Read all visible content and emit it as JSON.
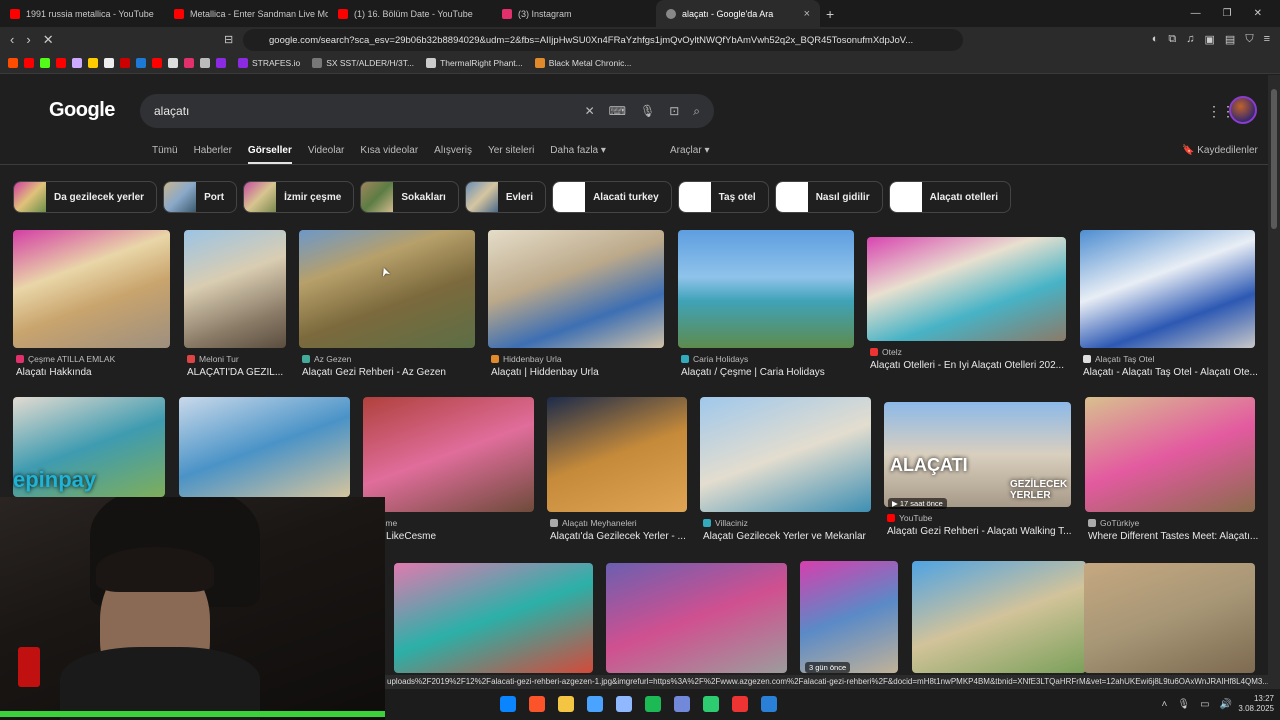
{
  "browser": {
    "tabs": [
      {
        "title": "1991 russia metallica - YouTube",
        "color": "#ff0000",
        "active": false
      },
      {
        "title": "Metallica - Enter Sandman Live Mosc...",
        "color": "#ff0000",
        "active": false
      },
      {
        "title": "(1) 16. Bölüm Date - YouTube",
        "color": "#ff0000",
        "active": false
      },
      {
        "title": "(3) Instagram",
        "color": "#e1306c",
        "active": false
      },
      {
        "title": "alaçatı - Google'da Ara",
        "color": "#ffffff",
        "active": true
      }
    ],
    "close_symbol": "×",
    "newtab_symbol": "+",
    "window_controls": [
      "—",
      "❐",
      "✕"
    ],
    "nav": {
      "back": "‹",
      "forward": "›",
      "reload": "✕"
    },
    "url": "google.com/search?sca_esv=29b06b32b8894029&udm=2&fbs=AIIjpHwSU0Xn4FRaYzhfgs1jmQvOyltNWQfYbAmVwh52q2x_BQR45TosonufmXdpJoV...",
    "bookmarks": [
      {
        "label": "STRAFES.io",
        "color": "#8a2be2"
      },
      {
        "label": "SX SST/ALDER/H/3T...",
        "color": "#777777"
      },
      {
        "label": "ThermalRight Phant...",
        "color": "#cccccc"
      },
      {
        "label": "Black Metal Chronic...",
        "color": "#e08a2b"
      }
    ],
    "bookmark_icon_colors": [
      "#ff4d00",
      "#ff0000",
      "#53fc18",
      "#ff0000",
      "#ccaaff",
      "#ffcc00",
      "#eeeeee",
      "#cc0000",
      "#1c7ad6",
      "#ff0000",
      "#dddddd",
      "#e1306c",
      "#bbbbbb",
      "#8a2be2"
    ]
  },
  "google": {
    "logo": "Google",
    "query": "alaçatı",
    "tabs": [
      "Tümü",
      "Haberler",
      "Görseller",
      "Videolar",
      "Kısa videolar",
      "Alışveriş",
      "Yer siteleri",
      "Daha fazla"
    ],
    "active_tab": "Görseller",
    "tools": "Araçlar",
    "saved": "Kaydedilenler",
    "chips": [
      {
        "label": "Da gezilecek yerler",
        "thumb": "photo"
      },
      {
        "label": "Port",
        "thumb": "photo"
      },
      {
        "label": "İzmir çeşme",
        "thumb": "photo"
      },
      {
        "label": "Sokakları",
        "thumb": "photo"
      },
      {
        "label": "Evleri",
        "thumb": "photo"
      },
      {
        "label": "Alacati turkey",
        "thumb": "white"
      },
      {
        "label": "Taş otel",
        "thumb": "white"
      },
      {
        "label": "Nasıl gidilir",
        "thumb": "white"
      },
      {
        "label": "Alaçatı otelleri",
        "thumb": "white"
      }
    ],
    "results_row1": [
      {
        "source": "Çeşme ATILLA EMLAK",
        "title": "Alaçatı Hakkında",
        "icon": "#e1306c"
      },
      {
        "source": "Meloni Tur",
        "title": "ALAÇATI'DA GEZİL...",
        "icon": "#d44"
      },
      {
        "source": "Az Gezen",
        "title": "Alaçatı Gezi Rehberi - Az Gezen",
        "icon": "#4a9"
      },
      {
        "source": "Hiddenbay Urla",
        "title": "Alaçatı | Hiddenbay Urla",
        "icon": "#e08a2b"
      },
      {
        "source": "Caria Holidays",
        "title": "Alaçatı / Çeşme | Caria Holidays",
        "icon": "#3ab"
      },
      {
        "source": "Otelz",
        "title": "Alaçatı Otelleri - En İyi Alaçatı Otelleri 202...",
        "icon": "#e33"
      },
      {
        "source": "Alaçatı Taş Otel",
        "title": "Alaçatı - Alaçatı Taş Otel - Alaçatı Ote...",
        "icon": "#ddd"
      }
    ],
    "results_row2": [
      {
        "source": "",
        "title": "",
        "icon": ""
      },
      {
        "source": "",
        "title": "",
        "icon": ""
      },
      {
        "source": "kCesme",
        "title": "atı - LikeCesme",
        "icon": ""
      },
      {
        "source": "Alaçatı Meyhaneleri",
        "title": "Alaçatı'da Gezilecek Yerler - ...",
        "icon": "#aaa"
      },
      {
        "source": "Villaciniz",
        "title": "Alaçatı Gezilecek Yerler ve Mekanlar",
        "icon": "#3ab"
      },
      {
        "source": "YouTube",
        "title": "Alaçatı Gezi Rehberi - Alaçatı Walking T...",
        "icon": "#f00"
      },
      {
        "source": "GoTürkiye",
        "title": "Where Different Tastes Meet: Alaçatı...",
        "icon": "#aaa"
      }
    ],
    "overlays": {
      "epinpay": "epinpay",
      "alacati": "ALAÇATI",
      "gezilecek": "GEZİLECEK YERLER",
      "video_badge": "▶ 17 saat önce",
      "days_badge": "3 gün önce"
    },
    "hover_url": "uploads%2F2019%2F12%2Falacati-gezi-rehberi-azgezen-1.jpg&imgrefurl=https%3A%2F%2Fwww.azgezen.com%2Falacati-gezi-rehberi%2F&docid=mH8t1nwPMKP4BM&tbnid=XNfE3LTQaHRFrM&vet=12ahUKEwi6j8L9tu6OAxWnJRAIHf8L4QM3..."
  },
  "taskbar": {
    "time": "13:27",
    "date": "3.08.2025",
    "app_colors": [
      "#0a84ff",
      "#fb542b",
      "#f4c542",
      "#4aa3ff",
      "#8fb8ff",
      "#1db954",
      "#7289da",
      "#2ecc71",
      "#e33",
      "#2a7fd6"
    ]
  }
}
